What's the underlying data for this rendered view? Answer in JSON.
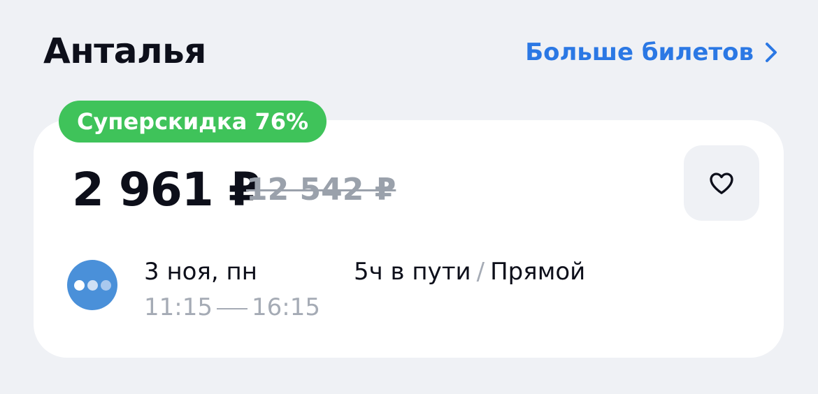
{
  "header": {
    "city": "Анталья",
    "more_tickets_label": "Больше билетов",
    "chevron_icon": "chevron-right-icon"
  },
  "offer": {
    "badge": "Суперскидка 76%",
    "price": "2 961 ₽",
    "old_price": "12 542 ₽",
    "favorite_icon": "heart-outline-icon",
    "airline_logo_icon": "airline-dots-logo",
    "date": "3 ноя, пн",
    "depart_time": "11:15",
    "arrive_time": "16:15",
    "duration": "5ч в пути",
    "separator": "/",
    "stops": "Прямой"
  },
  "colors": {
    "background": "#eff1f5",
    "accent_link": "#2b78e4",
    "badge_green": "#3fc35a",
    "muted_text": "#a5abb5",
    "airline_blue": "#4a90d9"
  }
}
